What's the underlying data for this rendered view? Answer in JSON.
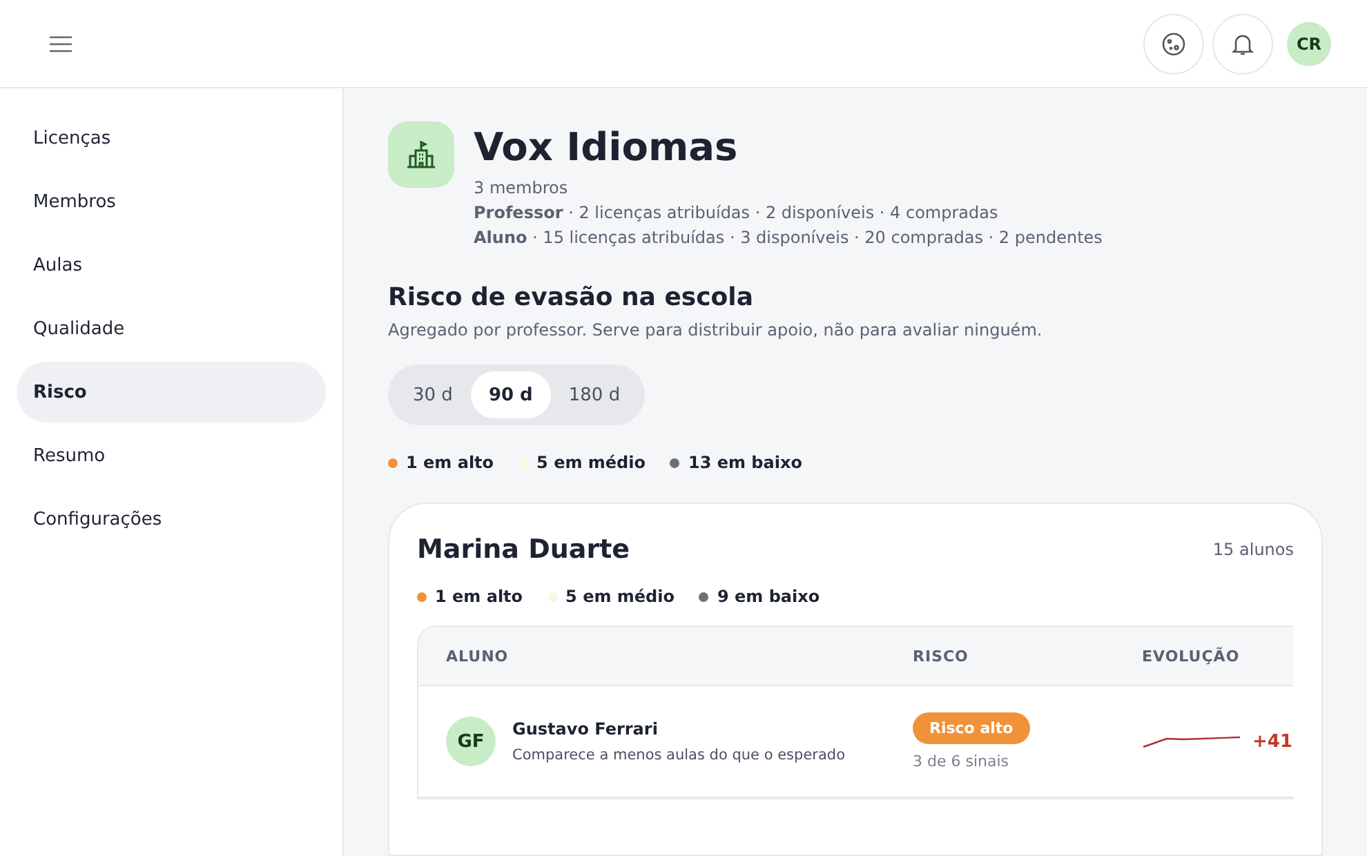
{
  "header": {
    "avatar_initials": "CR"
  },
  "sidebar": {
    "items": [
      {
        "label": "Licenças",
        "selected": false
      },
      {
        "label": "Membros",
        "selected": false
      },
      {
        "label": "Aulas",
        "selected": false
      },
      {
        "label": "Qualidade",
        "selected": false
      },
      {
        "label": "Risco",
        "selected": true
      },
      {
        "label": "Resumo",
        "selected": false
      },
      {
        "label": "Configurações",
        "selected": false
      }
    ]
  },
  "school": {
    "name": "Vox Idiomas",
    "members": "3 membros",
    "license_lines": [
      "**Professor** · 2 licenças atribuídas · 2 disponíveis · 4 compradas",
      "**Aluno** · 15 licenças atribuídas · 3 disponíveis · 20 compradas · 2 pendentes"
    ]
  },
  "risk": {
    "title": "Risco de evasão na escola",
    "subtitle": "Agregado por professor. Serve para distribuir apoio, não para avaliar ninguém.",
    "periods": [
      {
        "label": "30 d",
        "selected": false
      },
      {
        "label": "90 d",
        "selected": true
      },
      {
        "label": "180 d",
        "selected": false
      }
    ],
    "summary": [
      {
        "label": "1 em alto",
        "color": "#f0923a"
      },
      {
        "label": "5 em médio",
        "color": "#fbf6e2"
      },
      {
        "label": "13 em baixo",
        "color": "#6b6f7b"
      }
    ]
  },
  "teacher_card": {
    "name": "Marina Duarte",
    "count": "15 alunos",
    "summary": [
      {
        "label": "1 em alto",
        "color": "#f0923a"
      },
      {
        "label": "5 em médio",
        "color": "#fbf6e2"
      },
      {
        "label": "9 em baixo",
        "color": "#6b6f7b"
      }
    ],
    "table": {
      "columns": [
        "ALUNO",
        "RISCO",
        "EVOLUÇÃO"
      ],
      "rows": [
        {
          "initials": "GF",
          "name": "Gustavo Ferrari",
          "reason": "Comparece a menos aulas do que o esperado",
          "risk": "Risco alto",
          "color": "#f0923a",
          "signals": "3 de 6 sinais",
          "change": "+41"
        }
      ]
    }
  }
}
